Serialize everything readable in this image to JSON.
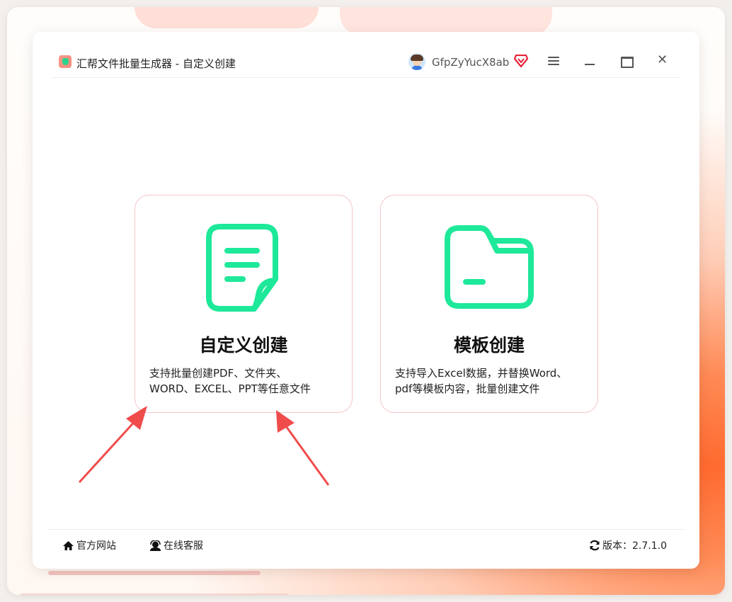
{
  "app": {
    "title": "汇帮文件批量生成器 - 自定义创建",
    "username": "GfpZyYucX8ab"
  },
  "cards": [
    {
      "title": "自定义创建",
      "desc_line1": "支持批量创建PDF、文件夹、",
      "desc_line2": "WORD、EXCEL、PPT等任意文件",
      "icon": "document-icon"
    },
    {
      "title": "模板创建",
      "desc_line1": "支持导入Excel数据，并替换Word、",
      "desc_line2": "pdf等模板内容，批量创建文件",
      "icon": "folder-icon"
    }
  ],
  "footer": {
    "website_label": "官方网站",
    "service_label": "在线客服",
    "version_label": "版本：2.7.1.0"
  },
  "colors": {
    "accent_green": "#1ee89a",
    "card_border": "#f3c6c8",
    "arrow_red": "#f04c4c",
    "vip_red": "#e8233a"
  }
}
